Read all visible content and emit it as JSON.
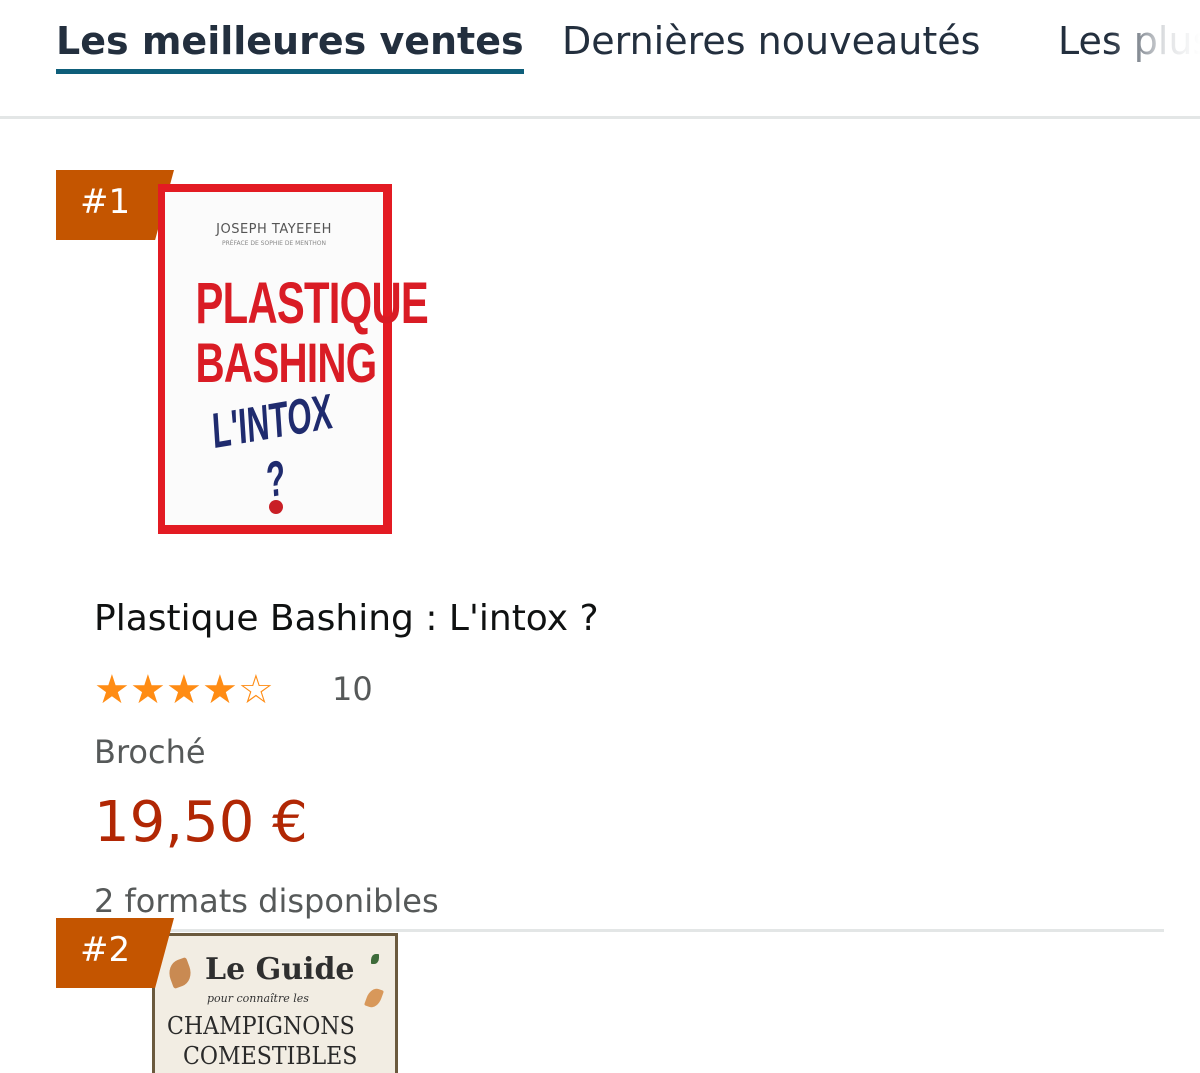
{
  "tabs": [
    {
      "label": "Les meilleures ventes",
      "active": true
    },
    {
      "label": "Dernières nouveautés",
      "active": false
    },
    {
      "label": "Les plus",
      "active": false
    }
  ],
  "products": [
    {
      "rank": "#1",
      "cover": {
        "author": "JOSEPH TAYEFEH",
        "preface": "PRÉFACE DE SOPHIE DE MENTHON",
        "title_line1": "PLASTIQUE",
        "title_line2": "BASHING",
        "title_line3": "L'INTOX ?"
      },
      "title": "Plastique Bashing : L'intox ?",
      "rating_stars": 4,
      "rating_stars_max": 5,
      "rating_count": "10",
      "format": "Broché",
      "price": "19,50 €",
      "more_formats": "2 formats disponibles"
    },
    {
      "rank": "#2",
      "cover": {
        "title": "Le Guide",
        "subtitle": "pour connaître les",
        "line1": "CHAMPIGNONS",
        "line2": "COMESTIBLES"
      }
    }
  ],
  "colors": {
    "badge": "#c45500",
    "price": "#b12704",
    "star": "#ff8c14",
    "tab_underline": "#0e5e7a"
  }
}
